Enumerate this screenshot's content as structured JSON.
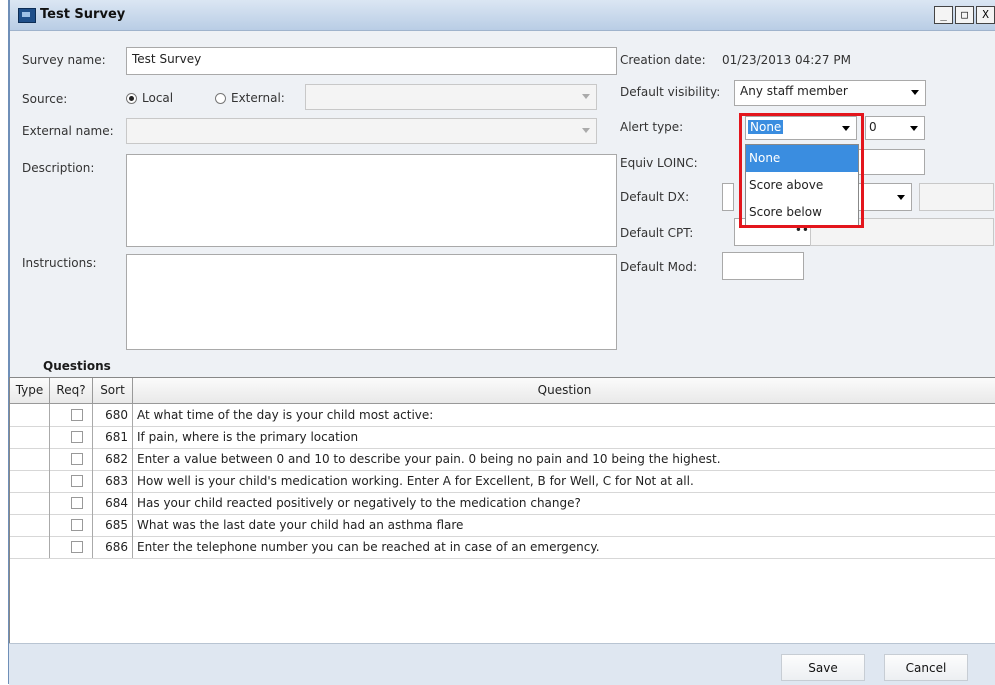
{
  "window": {
    "title": "Test Survey",
    "controls": [
      "_",
      "□",
      "X"
    ]
  },
  "form": {
    "survey_name_label": "Survey name:",
    "survey_name_value": "Test Survey",
    "source_label": "Source:",
    "source_local": "Local",
    "source_external": "External:",
    "external_name_label": "External name:",
    "description_label": "Description:",
    "instructions_label": "Instructions:",
    "creation_date_label": "Creation date:",
    "creation_date_value": "01/23/2013 04:27 PM",
    "default_visibility_label": "Default visibility:",
    "default_visibility_value": "Any staff member",
    "alert_type_label": "Alert type:",
    "alert_type_value": "None",
    "alert_number_value": "0",
    "equiv_loinc_label": "Equiv LOINC:",
    "default_dx_label": "Default DX:",
    "default_cpt_label": "Default CPT:",
    "default_cpt_dots": "••",
    "default_mod_label": "Default Mod:"
  },
  "alert_type_options": [
    {
      "label": "None",
      "selected": true
    },
    {
      "label": "Score above",
      "selected": false
    },
    {
      "label": "Score below",
      "selected": false
    }
  ],
  "questions": {
    "section_label": "Questions",
    "columns": [
      "Type",
      "Req?",
      "Sort",
      "Question"
    ],
    "rows": [
      {
        "type": "",
        "req": false,
        "sort": "680",
        "question": "At what time of the day is your child most active:"
      },
      {
        "type": "",
        "req": false,
        "sort": "681",
        "question": "If pain, where is the primary location"
      },
      {
        "type": "",
        "req": false,
        "sort": "682",
        "question": "Enter a value between 0 and 10 to describe your pain.  0 being no pain and 10 being the highest."
      },
      {
        "type": "",
        "req": false,
        "sort": "683",
        "question": "How well is your child's medication working.  Enter A for Excellent, B for Well, C for Not at all."
      },
      {
        "type": "",
        "req": false,
        "sort": "684",
        "question": "Has your child reacted positively or negatively to the medication change?"
      },
      {
        "type": "",
        "req": false,
        "sort": "685",
        "question": "What was the last date your child had an asthma flare"
      },
      {
        "type": "",
        "req": false,
        "sort": "686",
        "question": "Enter the telephone number you can be reached at in case of an emergency."
      }
    ]
  },
  "buttons": {
    "save": "Save",
    "cancel": "Cancel"
  },
  "colors": {
    "highlight_border": "#e3151c",
    "selected_option": "#3a8de0",
    "titlebar": "#c7d8ec"
  }
}
